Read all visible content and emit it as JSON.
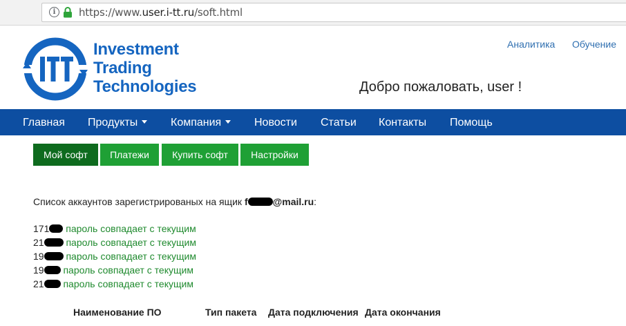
{
  "browser": {
    "url_prefix": "https://www.",
    "url_host": "user.i-tt.ru",
    "url_path": "/soft.html"
  },
  "logo": {
    "monogram": "ITT",
    "line1": "Investment",
    "line2": "Trading",
    "line3": "Technologies"
  },
  "top_links": {
    "analytics": "Аналитика",
    "learning": "Обучение"
  },
  "welcome": "Добро пожаловать, user !",
  "nav": {
    "items": [
      "Главная",
      "Продукты",
      "Компания",
      "Новости",
      "Статьи",
      "Контакты",
      "Помощь"
    ]
  },
  "tabs": [
    "Мой софт",
    "Платежи",
    "Купить софт",
    "Настройки"
  ],
  "accounts": {
    "intro": "Список аккаунтов зарегистрированых на ящик",
    "email_prefix": "f",
    "email_suffix": "@mail.ru",
    "colon": ":",
    "rows": [
      {
        "prefix": "171",
        "status": "пароль совпадает с текущим"
      },
      {
        "prefix": "21",
        "status": "пароль совпадает с текущим"
      },
      {
        "prefix": "19",
        "status": "пароль совпадает с текущим"
      },
      {
        "prefix": "19",
        "status": "пароль совпадает с текущим"
      },
      {
        "prefix": "21",
        "status": "пароль совпадает с текущим"
      }
    ]
  },
  "table": {
    "headers": [
      "Наименование ПО",
      "Тип пакета",
      "Дата подключения",
      "Дата окончания"
    ]
  },
  "colors": {
    "nav_bg": "#0d4ea1",
    "tab_active": "#0e6b1e",
    "tab_normal": "#1fa035",
    "brand_blue": "#1565c0",
    "status_green": "#1f8a2e"
  }
}
